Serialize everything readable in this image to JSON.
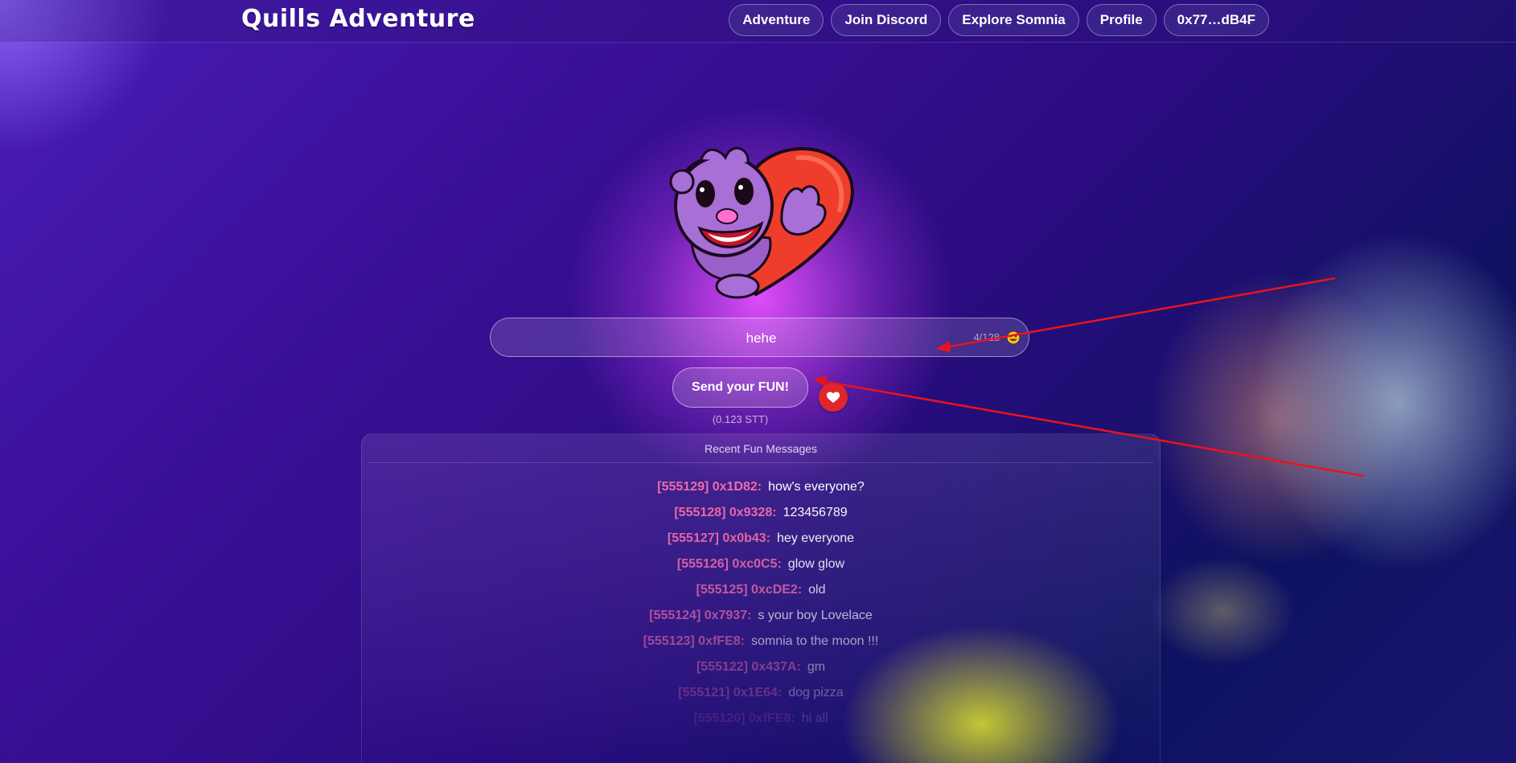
{
  "app": {
    "title": "Quills Adventure"
  },
  "nav": {
    "items": [
      {
        "label": "Adventure"
      },
      {
        "label": "Join Discord"
      },
      {
        "label": "Explore Somnia"
      },
      {
        "label": "Profile"
      },
      {
        "label": "0x77…dB4F"
      }
    ]
  },
  "composer": {
    "value": "hehe",
    "counter": "4/128",
    "send_label": "Send your FUN!",
    "price": "(0.123 STT)"
  },
  "messages": {
    "title": "Recent Fun Messages",
    "items": [
      {
        "meta": "[555129] 0x1D82:",
        "text": "how's everyone?"
      },
      {
        "meta": "[555128] 0x9328:",
        "text": "123456789"
      },
      {
        "meta": "[555127] 0x0b43:",
        "text": "hey everyone"
      },
      {
        "meta": "[555126] 0xc0C5:",
        "text": "glow glow"
      },
      {
        "meta": "[555125] 0xcDE2:",
        "text": "old"
      },
      {
        "meta": "[555124] 0x7937:",
        "text": "s your boy Lovelace"
      },
      {
        "meta": "[555123] 0xfFE8:",
        "text": "somnia to the moon !!!"
      },
      {
        "meta": "[555122] 0x437A:",
        "text": "gm"
      },
      {
        "meta": "[555121] 0x1E64:",
        "text": "dog pizza"
      },
      {
        "meta": "[555120] 0xfFE8:",
        "text": "hi all"
      }
    ]
  },
  "colors": {
    "accent_heart": "#e0262c",
    "message_meta": "#ef6ca6",
    "annotation_arrow": "#e8141c"
  },
  "icons": {
    "emoji": "smiley-emoji-icon",
    "heart": "heart-icon",
    "mascot": "mascot-heart-image"
  }
}
